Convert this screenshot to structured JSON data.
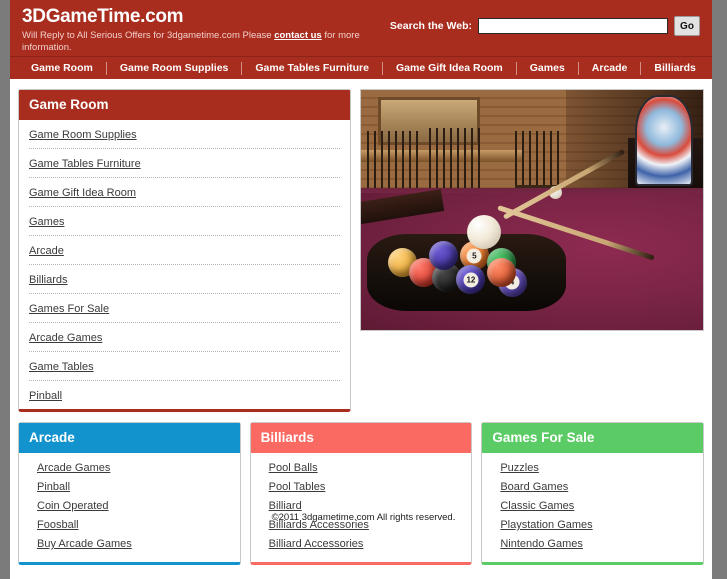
{
  "header": {
    "brand": "3DGameTime.com",
    "tagline_before": "Will Reply to All Serious Offers for 3dgametime.com Please ",
    "tagline_link": "contact us",
    "tagline_after": " for more information.",
    "search_label": "Search the Web:",
    "search_value": "",
    "search_placeholder": "",
    "search_button": "Go",
    "bg_color": "#a92d1f"
  },
  "nav": {
    "items": [
      {
        "label": "Game Room"
      },
      {
        "label": "Game Room Supplies"
      },
      {
        "label": "Game Tables Furniture"
      },
      {
        "label": "Game Gift Idea Room"
      },
      {
        "label": "Games"
      },
      {
        "label": "Arcade"
      },
      {
        "label": "Billiards"
      }
    ]
  },
  "main_panel": {
    "title": "Game Room",
    "accent": "#a92d1f",
    "links": [
      {
        "label": "Game Room Supplies"
      },
      {
        "label": "Game Tables Furniture"
      },
      {
        "label": "Game Gift Idea Room"
      },
      {
        "label": "Games"
      },
      {
        "label": "Arcade"
      },
      {
        "label": "Billiards"
      },
      {
        "label": "Games For Sale"
      },
      {
        "label": "Arcade Games"
      },
      {
        "label": "Game Tables"
      },
      {
        "label": "Pinball"
      }
    ]
  },
  "hero": {
    "alt": "billiards-table-photo",
    "balls": [
      {
        "num": "5"
      },
      {
        "num": "12"
      },
      {
        "num": "4"
      }
    ]
  },
  "panels": [
    {
      "title": "Arcade",
      "accent": "#1293ce",
      "links": [
        {
          "label": "Arcade Games"
        },
        {
          "label": "Pinball"
        },
        {
          "label": "Coin Operated"
        },
        {
          "label": "Foosball"
        },
        {
          "label": "Buy Arcade Games"
        }
      ]
    },
    {
      "title": "Billiards",
      "accent": "#fa6a63",
      "links": [
        {
          "label": "Pool Balls"
        },
        {
          "label": "Pool Tables"
        },
        {
          "label": "Billiard"
        },
        {
          "label": "Billiards Accessories"
        },
        {
          "label": "Billiard Accessories"
        }
      ]
    },
    {
      "title": "Games For Sale",
      "accent": "#5bcc65",
      "links": [
        {
          "label": "Puzzles"
        },
        {
          "label": "Board Games"
        },
        {
          "label": "Classic Games"
        },
        {
          "label": "Playstation Games"
        },
        {
          "label": "Nintendo Games"
        }
      ]
    }
  ],
  "footer": {
    "copyright": "©2011 3dgametime.com All rights reserved."
  }
}
